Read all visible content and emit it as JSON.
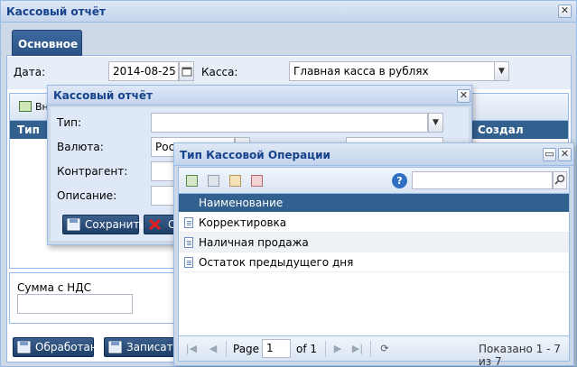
{
  "main_window": {
    "title": "Кассовый отчёт",
    "tab_label": "Основное",
    "date_label": "Дата:",
    "date_value": "2014-08-25",
    "cash_label": "Касса:",
    "cash_value": "Главная касса в рублях",
    "grid_toolbar_button": "Вн",
    "grid_columns": [
      "Тип",
      "Создал"
    ],
    "sum_label": "Сумма с НДС",
    "sum_value": "",
    "process_button": "Обработан",
    "write_button": "Записать"
  },
  "dialog_cash_report": {
    "title": "Кассовый отчёт",
    "type_label": "Тип:",
    "type_value": "",
    "currency_label": "Валюта:",
    "currency_value": "Рос",
    "counterparty_label": "Контрагент:",
    "description_label": "Описание:",
    "save_button": "Сохранить",
    "cancel_button_partial": "С"
  },
  "dialog_operation_type": {
    "title": "Тип Кассовой Операции",
    "search_placeholder": "",
    "column_header": "Наименование",
    "rows": [
      {
        "label": "Корректировка"
      },
      {
        "label": "Наличная продажа"
      },
      {
        "label": "Остаток предыдущего дня"
      }
    ],
    "pager": {
      "page_label": "Page",
      "page_value": "1",
      "of_label": "of 1",
      "status": "Показано 1 - 7 из 7"
    }
  },
  "colors": {
    "header_blue": "#33618f",
    "button_dark": "#2a5286",
    "window_border": "#99bbe8",
    "title_text": "#15428b"
  },
  "icons": [
    "close-icon",
    "calendar-icon",
    "chevron-down-icon",
    "save-icon",
    "cancel-icon",
    "maximize-icon",
    "add-icon",
    "edit-icon",
    "delete-icon",
    "help-icon",
    "search-icon",
    "first-page-icon",
    "prev-page-icon",
    "next-page-icon",
    "last-page-icon",
    "refresh-icon",
    "document-icon"
  ]
}
